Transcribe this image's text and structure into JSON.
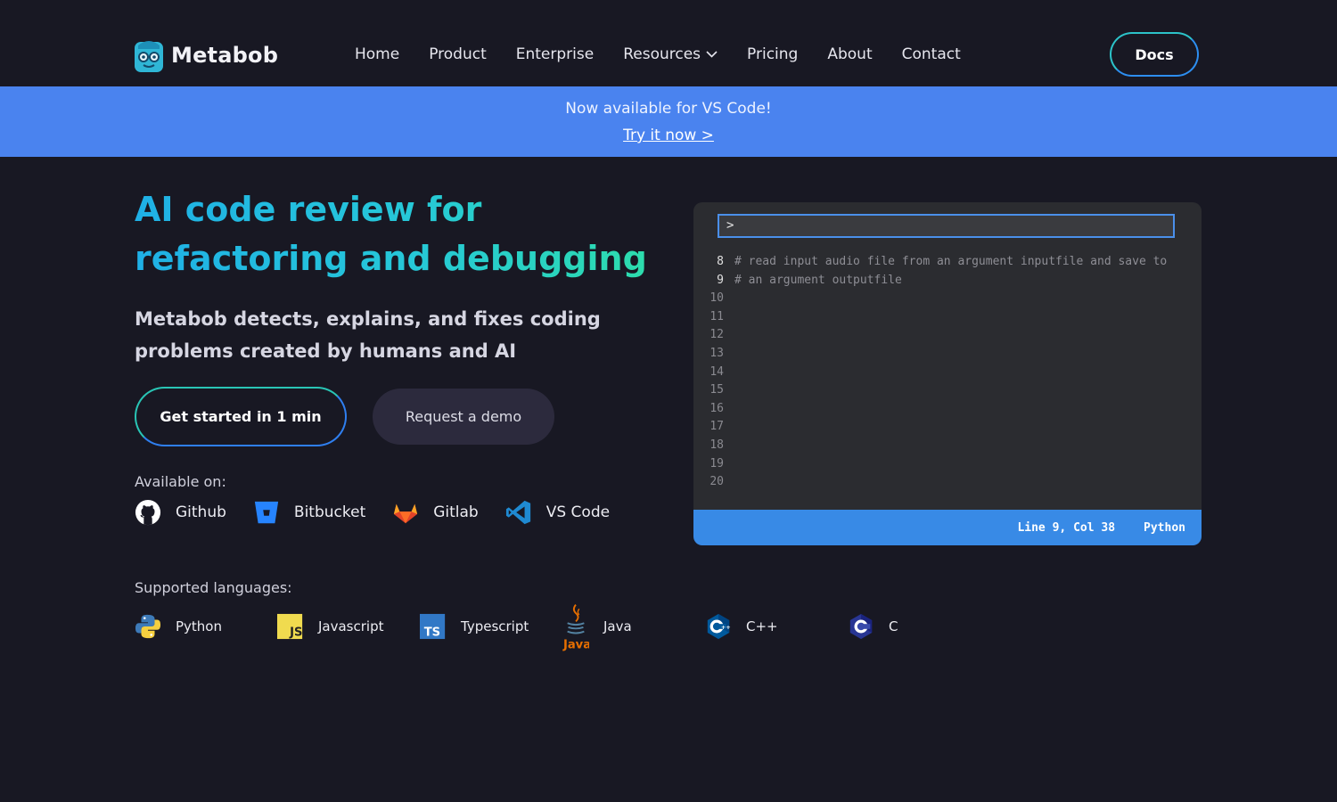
{
  "brand": {
    "name": "Metabob"
  },
  "nav": {
    "items": [
      {
        "label": "Home"
      },
      {
        "label": "Product"
      },
      {
        "label": "Enterprise"
      },
      {
        "label": "Resources",
        "dropdown": true
      },
      {
        "label": "Pricing"
      },
      {
        "label": "About"
      },
      {
        "label": "Contact"
      }
    ],
    "docs_label": "Docs"
  },
  "banner": {
    "text": "Now available for VS Code!",
    "link": "Try it now >"
  },
  "hero": {
    "title": "AI code review for refactoring and debugging",
    "subtitle": "Metabob detects, explains, and fixes coding problems created by humans and AI",
    "primary_cta": "Get started in 1 min",
    "secondary_cta": "Request a demo",
    "available_label": "Available on:",
    "platforms": [
      {
        "label": "Github",
        "icon": "github-icon"
      },
      {
        "label": "Bitbucket",
        "icon": "bitbucket-icon"
      },
      {
        "label": "Gitlab",
        "icon": "gitlab-icon"
      },
      {
        "label": "VS Code",
        "icon": "vscode-icon"
      }
    ],
    "languages_label": "Supported languages:",
    "languages": [
      {
        "label": "Python",
        "icon": "python-icon"
      },
      {
        "label": "Javascript",
        "icon": "javascript-icon"
      },
      {
        "label": "Typescript",
        "icon": "typescript-icon"
      },
      {
        "label": "Java",
        "icon": "java-icon"
      },
      {
        "label": "C++",
        "icon": "cpp-icon"
      },
      {
        "label": "C",
        "icon": "c-icon"
      }
    ]
  },
  "editor": {
    "prompt": ">",
    "lines": [
      {
        "num": "8",
        "text": "# read input audio file from an argument inputfile and save to"
      },
      {
        "num": "9",
        "text": "# an argument outputfile"
      },
      {
        "num": "10",
        "text": ""
      },
      {
        "num": "11",
        "text": ""
      },
      {
        "num": "12",
        "text": ""
      },
      {
        "num": "13",
        "text": ""
      },
      {
        "num": "14",
        "text": ""
      },
      {
        "num": "15",
        "text": ""
      },
      {
        "num": "16",
        "text": ""
      },
      {
        "num": "17",
        "text": ""
      },
      {
        "num": "18",
        "text": ""
      },
      {
        "num": "19",
        "text": ""
      },
      {
        "num": "20",
        "text": ""
      }
    ],
    "status_position": "Line 9, Col 38",
    "status_language": "Python"
  },
  "colors": {
    "background": "#181823",
    "banner": "#4a83ef",
    "accent_teal": "#2cc3c9",
    "accent_blue": "#2d8ef0",
    "statusbar": "#388ae6"
  }
}
